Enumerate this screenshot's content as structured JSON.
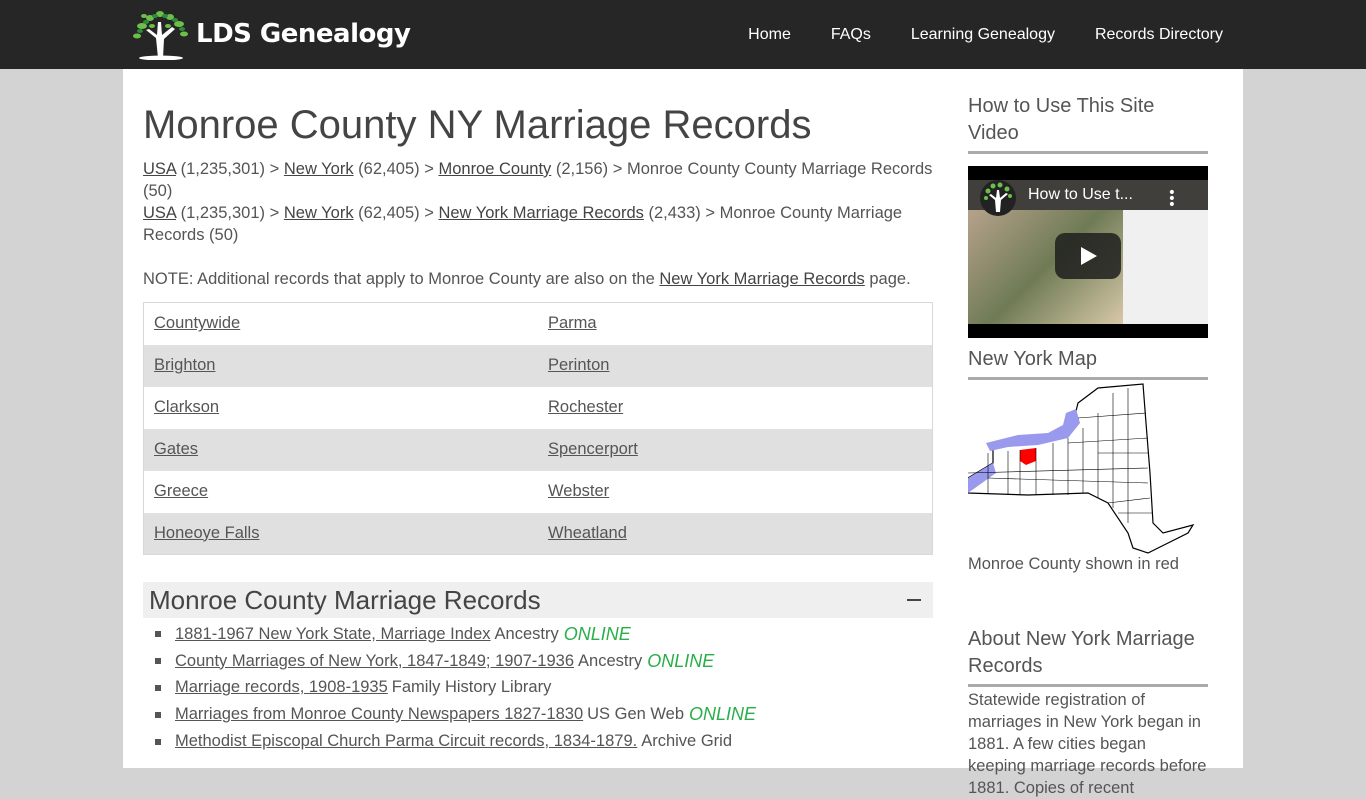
{
  "header": {
    "logo_text": "LDS Genealogy",
    "nav": [
      "Home",
      "FAQs",
      "Learning Genealogy",
      "Records Directory"
    ]
  },
  "main": {
    "title": "Monroe County NY Marriage Records",
    "breadcrumbs": [
      {
        "items": [
          {
            "link": "USA",
            "count": "(1,235,301)"
          },
          {
            "link": "New York",
            "count": "(62,405)"
          },
          {
            "link": "Monroe County",
            "count": "(2,156)"
          }
        ],
        "tail": "Monroe County County Marriage Records (50)"
      },
      {
        "items": [
          {
            "link": "USA",
            "count": "(1,235,301)"
          },
          {
            "link": "New York",
            "count": "(62,405)"
          },
          {
            "link": "New York Marriage Records",
            "count": "(2,433)"
          }
        ],
        "tail": "Monroe County Marriage Records (50)"
      }
    ],
    "separator": ">",
    "note": {
      "prefix": "NOTE: Additional records that apply to Monroe County are also on the ",
      "link": "New York Marriage Records",
      "suffix": " page."
    },
    "towns": [
      [
        "Countywide",
        "Parma"
      ],
      [
        "Brighton",
        "Perinton"
      ],
      [
        "Clarkson",
        "Rochester"
      ],
      [
        "Gates",
        "Spencerport"
      ],
      [
        "Greece",
        "Webster"
      ],
      [
        "Honeoye Falls",
        "Wheatland"
      ]
    ],
    "section": {
      "title": "Monroe County Marriage Records",
      "collapse_icon": "minus-icon",
      "records": [
        {
          "link": "1881-1967 New York State, Marriage Index",
          "source": "Ancestry",
          "online": "ONLINE"
        },
        {
          "link": "County Marriages of New York, 1847-1849; 1907-1936",
          "source": "Ancestry",
          "online": "ONLINE"
        },
        {
          "link": "Marriage records, 1908-1935",
          "source": "Family History Library",
          "online": null
        },
        {
          "link": "Marriages from Monroe County Newspapers 1827-1830",
          "source": "US Gen Web",
          "online": "ONLINE"
        },
        {
          "link": "Methodist Episcopal Church Parma Circuit records, 1834-1879.",
          "source": "Archive Grid",
          "online": null
        }
      ]
    }
  },
  "sidebar": {
    "video_heading": "How to Use This Site Video",
    "video_title": "How to Use t...",
    "map_heading": "New York Map",
    "map_caption": "Monroe County shown in red",
    "about_heading": "About New York Marriage Records",
    "about_text": "Statewide registration of marriages in New York began in 1881. A few cities began keeping marriage records before 1881. Copies of recent"
  },
  "colors": {
    "header_bg": "#262626",
    "online_green": "#2aae4a",
    "highlight_red": "#ff0000",
    "lake_blue": "#9999ee"
  }
}
